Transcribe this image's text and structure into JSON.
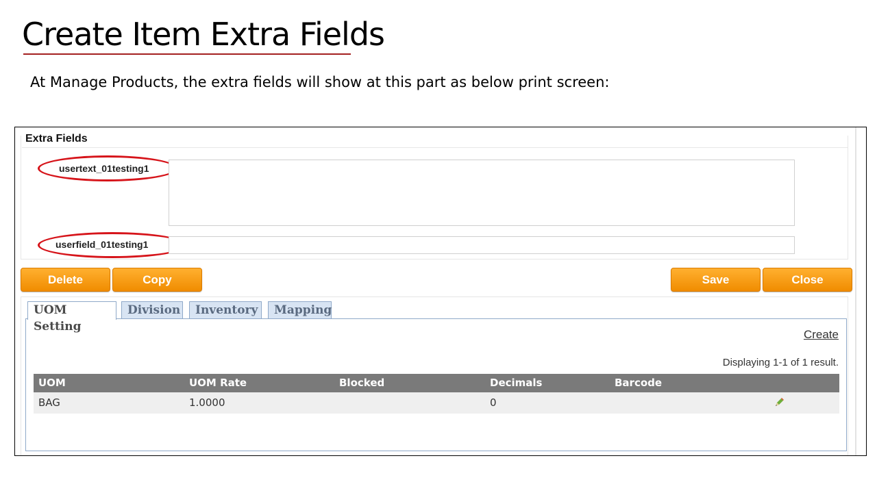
{
  "slide": {
    "title": "Create Item Extra Fields",
    "subtitle": "At Manage Products, the extra fields will show at this part as below print screen:",
    "accent_color": "#a31f1f",
    "highlight_color": "#d6141a"
  },
  "extra_fields": {
    "legend": "Extra Fields",
    "fields": [
      {
        "label": "usertext_01testing1",
        "type": "textarea",
        "value": ""
      },
      {
        "label": "userfield_01testing1",
        "type": "text",
        "value": ""
      }
    ]
  },
  "actions": {
    "delete_label": "Delete",
    "copy_label": "Copy",
    "save_label": "Save",
    "close_label": "Close",
    "button_color": "#f7a11a"
  },
  "tabs": [
    {
      "label": "UOM Setting",
      "active": true
    },
    {
      "label": "Division",
      "active": false
    },
    {
      "label": "Inventory",
      "active": false
    },
    {
      "label": "Mapping",
      "active": false
    }
  ],
  "uom_panel": {
    "create_link": "Create",
    "summary": "Displaying 1-1 of 1 result.",
    "columns": [
      "UOM",
      "UOM Rate",
      "Blocked",
      "Decimals",
      "Barcode",
      ""
    ],
    "rows": [
      {
        "uom": "BAG",
        "uom_rate": "1.0000",
        "blocked": "",
        "decimals": "0",
        "barcode": "",
        "action_icon": "pencil-edit-icon"
      }
    ]
  }
}
